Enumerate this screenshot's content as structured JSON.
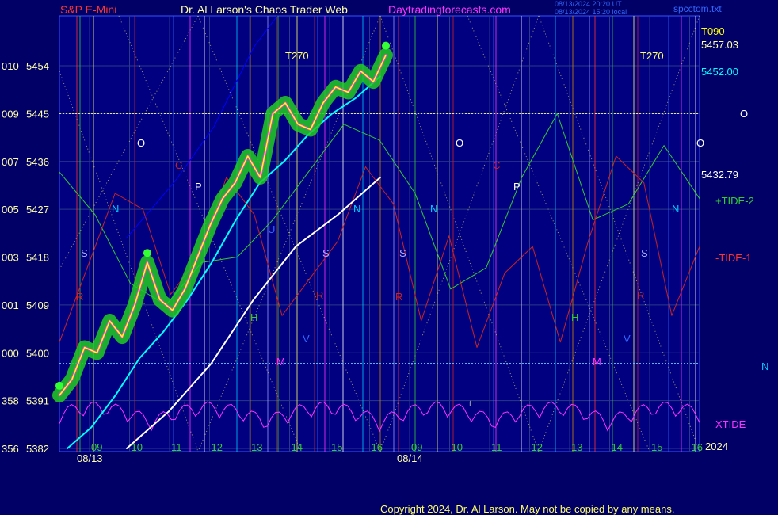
{
  "header": {
    "symbol": "S&P E-Mini",
    "title": "Dr. Al Larson's Chaos Trader Web",
    "site": "Daytradingforecasts.com",
    "stamp1": "08/13/2024 20:20 UT",
    "stamp2": "08/13/2024 15:20 local",
    "file": "spcctom.txt"
  },
  "footer": {
    "copyright": "Copyright 2024, Dr. Al Larson. May not be copied by any means."
  },
  "colors": {
    "background": "#000066",
    "plot_bg": "#000080",
    "price_line": "#ffff00",
    "price_glow": "#22cc22",
    "moving_average": "#00ffff",
    "tide2": "#33cc33",
    "tide1": "#cc2222",
    "xtide": "#ff33ff",
    "white_line": "#ffffff",
    "dark_blue_line": "#0000ff"
  },
  "chart_data": {
    "type": "line",
    "y_axis_ticks": [
      {
        "left": "356",
        "value": 5382
      },
      {
        "left": "358",
        "value": 5391
      },
      {
        "left": "000",
        "value": 5400
      },
      {
        "left": "001",
        "value": 5409
      },
      {
        "left": "003",
        "value": 5418
      },
      {
        "left": "005",
        "value": 5427
      },
      {
        "left": "007",
        "value": 5436
      },
      {
        "left": "009",
        "value": 5445
      },
      {
        "left": "010",
        "value": 5454
      }
    ],
    "ylim": [
      5382,
      5458
    ],
    "x_hour_labels": [
      "09",
      "10",
      "11",
      "12",
      "13",
      "14",
      "15",
      "16",
      "09",
      "10",
      "11",
      "12",
      "13",
      "14",
      "15",
      "16"
    ],
    "date_labels": [
      "08/13",
      "08/14"
    ],
    "year_label": "2024",
    "right_value_labels": [
      {
        "text": "T090"
      },
      {
        "text": "5457.03"
      },
      {
        "text": "5452.00"
      },
      {
        "text": "5432.79"
      }
    ],
    "series_labels": [
      "+TIDE-2",
      "-TIDE-1",
      "XTIDE"
    ],
    "small_right_labels": [
      "O",
      "N"
    ],
    "annotation_letters": [
      "T270",
      "T270",
      "O",
      "O",
      "O",
      "N",
      "N",
      "N",
      "N",
      "C",
      "C",
      "P",
      "P",
      "S",
      "S",
      "S",
      "S",
      "R",
      "R",
      "R",
      "R",
      "H",
      "H",
      "U",
      "V",
      "V",
      "M",
      "M",
      "t",
      "t"
    ],
    "price_series": {
      "name": "S&P E-Mini",
      "y": [
        5392,
        5395,
        5401,
        5400,
        5406,
        5403,
        5409,
        5417,
        5410,
        5408,
        5412,
        5418,
        5424,
        5429,
        5432,
        5437,
        5433,
        5445,
        5447,
        5443,
        5442,
        5447,
        5450,
        5449,
        5453,
        5451,
        5456
      ]
    },
    "moving_average": {
      "y": [
        5382,
        5386,
        5392,
        5399,
        5404,
        5410,
        5417,
        5425,
        5432,
        5436,
        5441,
        5445,
        5448,
        5452
      ]
    },
    "tide_2": {
      "y": [
        5434,
        5426,
        5413,
        5409,
        5417,
        5418,
        5425,
        5434,
        5443,
        5440,
        5430,
        5412,
        5416,
        5433,
        5445,
        5425,
        5428,
        5439,
        5429
      ]
    },
    "tide_1": {
      "y": [
        5402,
        5416,
        5430,
        5427,
        5411,
        5418,
        5433,
        5426,
        5407,
        5414,
        5421,
        5435,
        5428,
        5406,
        5422,
        5401,
        5415,
        5420,
        5402,
        5421,
        5437,
        5432,
        5407,
        5420
      ]
    },
    "white_line": {
      "y": [
        5382,
        5389,
        5398,
        5410,
        5420,
        5426,
        5433
      ]
    },
    "horizontal_levels": [
      5445,
      5398
    ]
  }
}
